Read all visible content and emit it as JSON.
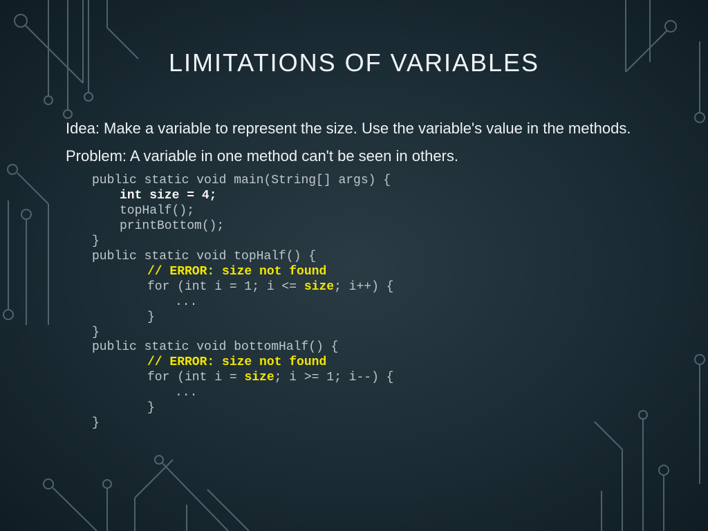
{
  "title": "LIMITATIONS OF VARIABLES",
  "idea": "Idea: Make a variable to represent the size. Use the variable's value in the methods.",
  "problem": "Problem: A variable in one method can't be seen in others.",
  "code": {
    "l01": "public static void main(String[] args) {",
    "l02": "int size = 4;",
    "l03": "topHalf();",
    "l04": "printBottom();",
    "l05": "}",
    "l06": "public static void topHalf() {",
    "l07": "// ERROR: size not found",
    "l08a": "for (int i = 1; i <= ",
    "l08b": "size",
    "l08c": "; i++) {",
    "l09": "...",
    "l10": "}",
    "l11": "}",
    "l12": "public static void bottomHalf() {",
    "l13": "// ERROR: size not found",
    "l14a": "for (int i = ",
    "l14b": "size",
    "l14c": "; i >= 1; i--) {",
    "l15": "...",
    "l16": "}",
    "l17": "}"
  }
}
